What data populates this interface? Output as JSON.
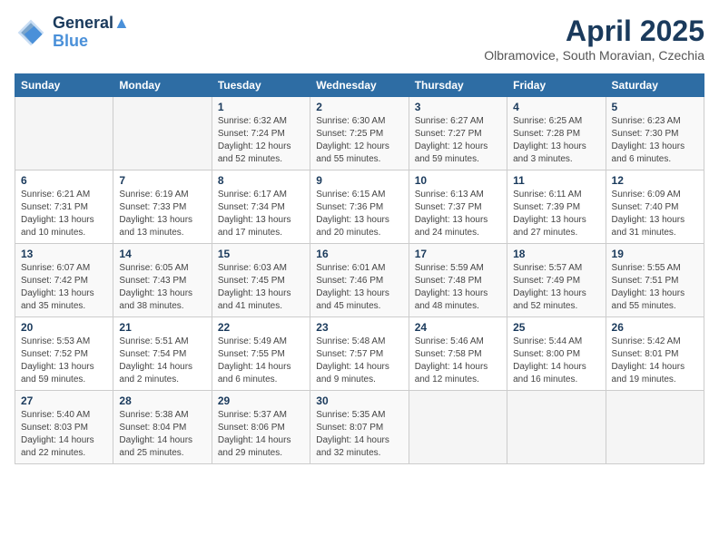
{
  "header": {
    "logo_line1": "General",
    "logo_line2": "Blue",
    "title": "April 2025",
    "subtitle": "Olbramovice, South Moravian, Czechia"
  },
  "weekdays": [
    "Sunday",
    "Monday",
    "Tuesday",
    "Wednesday",
    "Thursday",
    "Friday",
    "Saturday"
  ],
  "weeks": [
    [
      {
        "day": "",
        "detail": ""
      },
      {
        "day": "",
        "detail": ""
      },
      {
        "day": "1",
        "detail": "Sunrise: 6:32 AM\nSunset: 7:24 PM\nDaylight: 12 hours\nand 52 minutes."
      },
      {
        "day": "2",
        "detail": "Sunrise: 6:30 AM\nSunset: 7:25 PM\nDaylight: 12 hours\nand 55 minutes."
      },
      {
        "day": "3",
        "detail": "Sunrise: 6:27 AM\nSunset: 7:27 PM\nDaylight: 12 hours\nand 59 minutes."
      },
      {
        "day": "4",
        "detail": "Sunrise: 6:25 AM\nSunset: 7:28 PM\nDaylight: 13 hours\nand 3 minutes."
      },
      {
        "day": "5",
        "detail": "Sunrise: 6:23 AM\nSunset: 7:30 PM\nDaylight: 13 hours\nand 6 minutes."
      }
    ],
    [
      {
        "day": "6",
        "detail": "Sunrise: 6:21 AM\nSunset: 7:31 PM\nDaylight: 13 hours\nand 10 minutes."
      },
      {
        "day": "7",
        "detail": "Sunrise: 6:19 AM\nSunset: 7:33 PM\nDaylight: 13 hours\nand 13 minutes."
      },
      {
        "day": "8",
        "detail": "Sunrise: 6:17 AM\nSunset: 7:34 PM\nDaylight: 13 hours\nand 17 minutes."
      },
      {
        "day": "9",
        "detail": "Sunrise: 6:15 AM\nSunset: 7:36 PM\nDaylight: 13 hours\nand 20 minutes."
      },
      {
        "day": "10",
        "detail": "Sunrise: 6:13 AM\nSunset: 7:37 PM\nDaylight: 13 hours\nand 24 minutes."
      },
      {
        "day": "11",
        "detail": "Sunrise: 6:11 AM\nSunset: 7:39 PM\nDaylight: 13 hours\nand 27 minutes."
      },
      {
        "day": "12",
        "detail": "Sunrise: 6:09 AM\nSunset: 7:40 PM\nDaylight: 13 hours\nand 31 minutes."
      }
    ],
    [
      {
        "day": "13",
        "detail": "Sunrise: 6:07 AM\nSunset: 7:42 PM\nDaylight: 13 hours\nand 35 minutes."
      },
      {
        "day": "14",
        "detail": "Sunrise: 6:05 AM\nSunset: 7:43 PM\nDaylight: 13 hours\nand 38 minutes."
      },
      {
        "day": "15",
        "detail": "Sunrise: 6:03 AM\nSunset: 7:45 PM\nDaylight: 13 hours\nand 41 minutes."
      },
      {
        "day": "16",
        "detail": "Sunrise: 6:01 AM\nSunset: 7:46 PM\nDaylight: 13 hours\nand 45 minutes."
      },
      {
        "day": "17",
        "detail": "Sunrise: 5:59 AM\nSunset: 7:48 PM\nDaylight: 13 hours\nand 48 minutes."
      },
      {
        "day": "18",
        "detail": "Sunrise: 5:57 AM\nSunset: 7:49 PM\nDaylight: 13 hours\nand 52 minutes."
      },
      {
        "day": "19",
        "detail": "Sunrise: 5:55 AM\nSunset: 7:51 PM\nDaylight: 13 hours\nand 55 minutes."
      }
    ],
    [
      {
        "day": "20",
        "detail": "Sunrise: 5:53 AM\nSunset: 7:52 PM\nDaylight: 13 hours\nand 59 minutes."
      },
      {
        "day": "21",
        "detail": "Sunrise: 5:51 AM\nSunset: 7:54 PM\nDaylight: 14 hours\nand 2 minutes."
      },
      {
        "day": "22",
        "detail": "Sunrise: 5:49 AM\nSunset: 7:55 PM\nDaylight: 14 hours\nand 6 minutes."
      },
      {
        "day": "23",
        "detail": "Sunrise: 5:48 AM\nSunset: 7:57 PM\nDaylight: 14 hours\nand 9 minutes."
      },
      {
        "day": "24",
        "detail": "Sunrise: 5:46 AM\nSunset: 7:58 PM\nDaylight: 14 hours\nand 12 minutes."
      },
      {
        "day": "25",
        "detail": "Sunrise: 5:44 AM\nSunset: 8:00 PM\nDaylight: 14 hours\nand 16 minutes."
      },
      {
        "day": "26",
        "detail": "Sunrise: 5:42 AM\nSunset: 8:01 PM\nDaylight: 14 hours\nand 19 minutes."
      }
    ],
    [
      {
        "day": "27",
        "detail": "Sunrise: 5:40 AM\nSunset: 8:03 PM\nDaylight: 14 hours\nand 22 minutes."
      },
      {
        "day": "28",
        "detail": "Sunrise: 5:38 AM\nSunset: 8:04 PM\nDaylight: 14 hours\nand 25 minutes."
      },
      {
        "day": "29",
        "detail": "Sunrise: 5:37 AM\nSunset: 8:06 PM\nDaylight: 14 hours\nand 29 minutes."
      },
      {
        "day": "30",
        "detail": "Sunrise: 5:35 AM\nSunset: 8:07 PM\nDaylight: 14 hours\nand 32 minutes."
      },
      {
        "day": "",
        "detail": ""
      },
      {
        "day": "",
        "detail": ""
      },
      {
        "day": "",
        "detail": ""
      }
    ]
  ]
}
